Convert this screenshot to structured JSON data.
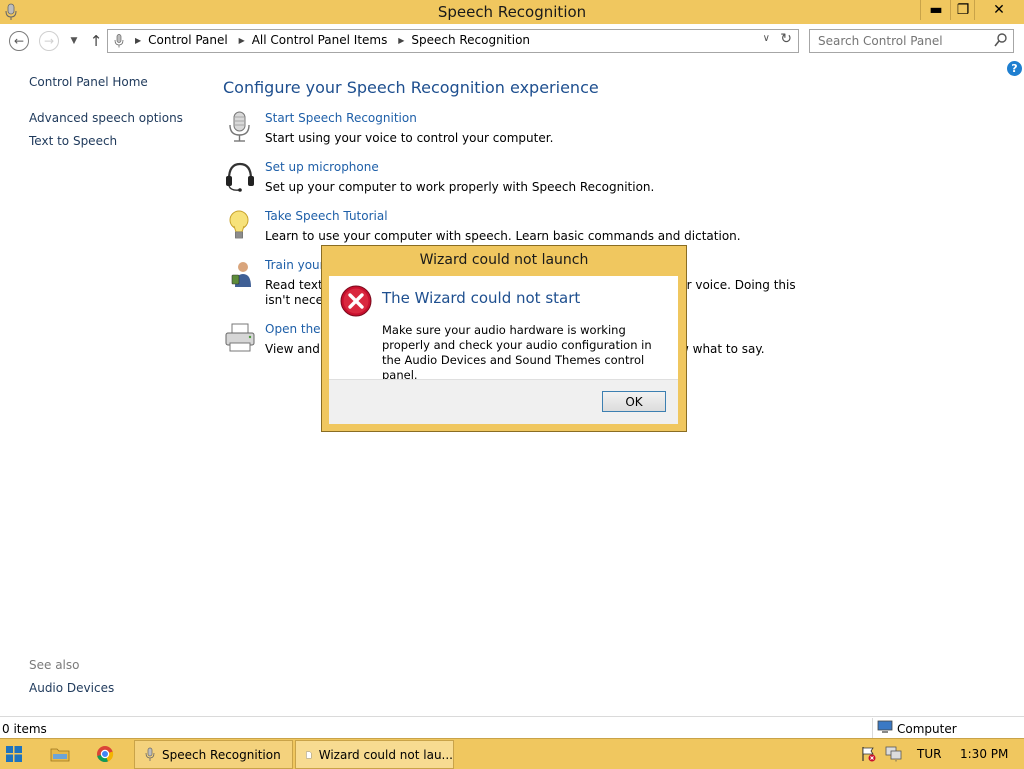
{
  "window": {
    "title": "Speech Recognition",
    "controls": {
      "minimize": "▬",
      "maximize": "❐",
      "close": "✕"
    }
  },
  "address": {
    "breadcrumbs": [
      "Control Panel",
      "All Control Panel Items",
      "Speech Recognition"
    ],
    "search_placeholder": "Search Control Panel"
  },
  "sidebar": {
    "home": "Control Panel Home",
    "links": [
      "Advanced speech options",
      "Text to Speech"
    ],
    "see_also_label": "See also",
    "see_also_links": [
      "Audio Devices"
    ]
  },
  "main": {
    "heading": "Configure your Speech Recognition experience",
    "tasks": [
      {
        "icon": "microphone-icon",
        "link": "Start Speech Recognition",
        "desc": "Start using your voice to control your computer.",
        "desc2": ""
      },
      {
        "icon": "headset-icon",
        "link": "Set up microphone",
        "desc": "Set up your computer to work properly with Speech Recognition.",
        "desc2": ""
      },
      {
        "icon": "lightbulb-icon",
        "link": "Take Speech Tutorial",
        "desc": "Learn to use your computer with speech.  Learn basic commands and dictation.",
        "desc2": ""
      },
      {
        "icon": "user-icon",
        "link": "Train your",
        "desc": "Read text t",
        "desc_right": "ur voice.  Doing this",
        "desc2": "isn't neces"
      },
      {
        "icon": "printer-icon",
        "link": "Open the S",
        "desc": "View and p",
        "desc_right": "w what to say.",
        "desc2": ""
      }
    ]
  },
  "dialog": {
    "title": "Wizard could not launch",
    "heading": "The Wizard could not start",
    "message": "Make sure your audio hardware is working properly and check your audio configuration in the Audio Devices and Sound Themes control panel.",
    "ok_label": "OK"
  },
  "statusbar": {
    "items": "0 items",
    "location": "Computer"
  },
  "taskbar": {
    "tasks": [
      "Speech Recognition",
      "Wizard could not lau..."
    ],
    "language": "TUR",
    "time": "1:30 PM"
  },
  "colors": {
    "title_bar": "#f0c75f",
    "link_blue": "#1e5fa8",
    "heading_blue": "#1e4f8f"
  }
}
